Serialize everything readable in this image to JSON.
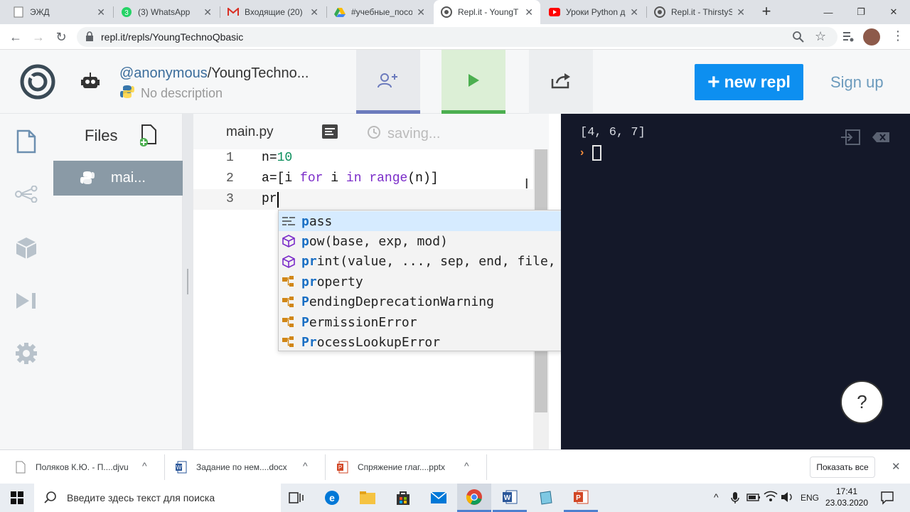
{
  "browser": {
    "tabs": [
      {
        "title": "ЭЖД",
        "icon": "document-icon",
        "active": false
      },
      {
        "title": "(3) WhatsApp",
        "icon": "whatsapp-icon",
        "active": false
      },
      {
        "title": "Входящие (20)",
        "icon": "gmail-icon",
        "active": false
      },
      {
        "title": "#учебные_посо",
        "icon": "drive-icon",
        "active": false
      },
      {
        "title": "Repl.it - YoungT",
        "icon": "replit-icon",
        "active": true
      },
      {
        "title": "Уроки Python д",
        "icon": "youtube-icon",
        "active": false
      },
      {
        "title": "Repl.it - ThirstyS",
        "icon": "replit-icon",
        "active": false
      }
    ],
    "new_tab_label": "+",
    "url": "repl.it/repls/YoungTechnoQbasic"
  },
  "header": {
    "owner": "@anonymous",
    "repl_name": "/YoungTechno...",
    "description": "No description",
    "new_repl_label": "new repl",
    "sign_up_label": "Sign up"
  },
  "files": {
    "title": "Files",
    "items": [
      {
        "name": "mai..."
      }
    ]
  },
  "editor": {
    "tab": "main.py",
    "status": "saving...",
    "lines": [
      {
        "num": "1",
        "text": "n=10"
      },
      {
        "num": "2",
        "text": "a=[i for i in range(n)]"
      },
      {
        "num": "3",
        "text": "pr"
      }
    ]
  },
  "autocomplete": {
    "items": [
      {
        "match": "p",
        "rest": "ass",
        "kind": "keyword-icon",
        "selected": true
      },
      {
        "match": "p",
        "rest": "ow(base, exp, mod)",
        "kind": "function-icon",
        "selected": false
      },
      {
        "match": "pr",
        "rest": "int(value, ..., sep, end, file, flush)",
        "kind": "function-icon",
        "selected": false
      },
      {
        "match": "pr",
        "rest": "operty",
        "kind": "class-icon",
        "selected": false
      },
      {
        "match": "P",
        "rest": "endingDeprecationWarning",
        "kind": "class-icon",
        "selected": false
      },
      {
        "match": "P",
        "rest": "ermissionError",
        "kind": "class-icon",
        "selected": false
      },
      {
        "match": "Pr",
        "rest": "ocessLookupError",
        "kind": "class-icon",
        "selected": false
      }
    ]
  },
  "console": {
    "output": "[4, 6, 7]",
    "help_label": "?"
  },
  "downloads": {
    "items": [
      {
        "name": "Поляков К.Ю. - П....djvu",
        "icon": "djvu-file-icon"
      },
      {
        "name": "Задание по нем....docx",
        "icon": "word-file-icon"
      },
      {
        "name": "Спряжение глаг....pptx",
        "icon": "pptx-file-icon"
      }
    ],
    "show_all_label": "Показать все"
  },
  "taskbar": {
    "search_placeholder": "Введите здесь текст для поиска",
    "language": "ENG",
    "time": "17:41",
    "date": "23.03.2020"
  },
  "colors": {
    "accent": "#0d8ff0",
    "console_bg": "#141829",
    "invite_bar": "#6c7bbd",
    "run_bar": "#4caf50"
  }
}
